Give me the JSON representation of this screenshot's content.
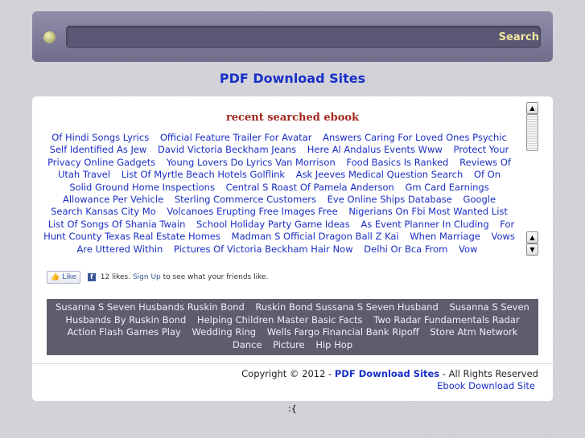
{
  "search": {
    "button_label": "Search"
  },
  "site": {
    "title": "PDF Download Sites"
  },
  "recent": {
    "title": "recent searched ebook",
    "links": [
      "Of Hindi Songs Lyrics",
      "Official Feature Trailer For Avatar",
      "Answers Caring For Loved Ones Psychic",
      "Self Identified As Jew",
      "David Victoria Beckham Jeans",
      "Here Al Andalus Events Www",
      "Protect Your",
      "Privacy Online Gadgets",
      "Young Lovers Do Lyrics Van Morrison",
      "Food Basics Is Ranked",
      "Reviews Of",
      "Utah Travel",
      "List Of Myrtle Beach Hotels Golflink",
      "Ask Jeeves Medical Question Search",
      "Of On",
      "Solid Ground Home Inspections",
      "Central S Roast Of Pamela Anderson",
      "Gm Card Earnings",
      "Allowance Per Vehicle",
      "Sterling Commerce Customers",
      "Eve Online Ships Database",
      "Google",
      "Search Kansas City Mo",
      "Volcanoes Erupting Free Images Free",
      "Nigerians On Fbi Most Wanted List",
      "List Of Songs Of Shania Twain",
      "School Holiday Party Game Ideas",
      "As Event Planner In Cluding",
      "For Hunt County Texas Real Estate Homes",
      "Madman S Official Dragon Ball Z Kai",
      "When Marriage",
      "Vows Are Uttered Within",
      "Pictures Of Victoria Beckham Hair Now",
      "Delhi Or Bca From",
      "Vow"
    ]
  },
  "facebook": {
    "like_label": "Like",
    "likes_text": "12 likes.",
    "signup_label": "Sign Up",
    "after_text": "to see what your friends like."
  },
  "tags": [
    "Susanna S Seven Husbands Ruskin Bond",
    "Ruskin Bond Sussana S Seven Husband",
    "Susanna S Seven",
    "Husbands By Ruskin Bond",
    "Helping Children Master Basic Facts",
    "Two Radar Fundamentals Radar",
    "Action Flash Games Play",
    "Wedding Ring",
    "Wells Fargo Financial Bank Ripoff",
    "Store Atm Network",
    "Dance",
    "Picture",
    "Hip Hop"
  ],
  "footer": {
    "copyright": "Copyright © 2012 -",
    "site_name": "PDF Download Sites",
    "rights": "- All Rights Reserved",
    "link": "Ebook Download Site"
  },
  "misc": {
    "smiley": ":{"
  }
}
